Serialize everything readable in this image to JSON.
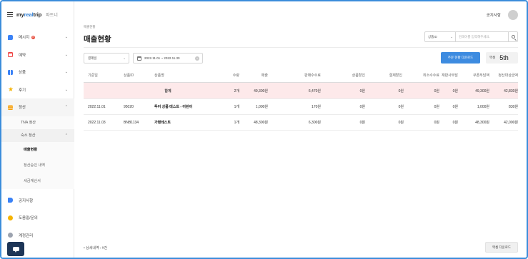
{
  "brand": {
    "logo_prefix": "my",
    "logo_accent": "real",
    "logo_suffix": "trip",
    "partner_label": "파트너"
  },
  "colors": {
    "accent": "#3d8be0",
    "total_row": "#fde9ea",
    "frame": "#3b8ddb",
    "sidebar_active": "#f5f5f5"
  },
  "sidebar": {
    "items": [
      {
        "label": "메시지",
        "icon": "message-icon",
        "icon_color": "#3b82f6",
        "badge": "N"
      },
      {
        "label": "예약",
        "icon": "calendar-icon",
        "icon_color": "#ef4444"
      },
      {
        "label": "상품",
        "icon": "grid-icon",
        "icon_color": "#3b82f6"
      },
      {
        "label": "후기",
        "icon": "star-icon",
        "icon_color": "#f5b301"
      },
      {
        "label": "정산",
        "icon": "settlement-icon",
        "icon_color": "#f59e0b"
      }
    ],
    "settlement_sub": [
      {
        "label": "TNA 정산"
      },
      {
        "label": "숙소 정산"
      }
    ],
    "lodging_sub": [
      {
        "label": "매출현황"
      },
      {
        "label": "정산승인 내역"
      },
      {
        "label": "세금계산서"
      }
    ],
    "bottom_items": [
      {
        "label": "공지사항",
        "icon": "megaphone-icon",
        "icon_color": "#3b82f6"
      },
      {
        "label": "도움말/문의",
        "icon": "help-icon",
        "icon_color": "#f5b301"
      },
      {
        "label": "계정관리",
        "icon": "gear-icon",
        "icon_color": "#9ca3af"
      }
    ]
  },
  "topbar": {
    "notice": "공지사항"
  },
  "page": {
    "breadcrumb": "매출현황",
    "title": "매출현황"
  },
  "search": {
    "select_value": "상품ID",
    "placeholder": "검색어를 입력해주세요."
  },
  "filters": {
    "period_value": "결제일",
    "date_range": "2022.11.01 ~ 2022.11.30"
  },
  "actions": {
    "download_label": "주문 현황 다운로드",
    "excel_small": "엑셀",
    "excel_big": "5th"
  },
  "table": {
    "headers": [
      "기준일",
      "상품ID",
      "상품명",
      "수량",
      "매출",
      "판매수수료",
      "상품할인",
      "결제할인",
      "취소수수료",
      "재판사부담",
      "쿠폰부담액",
      "정산대상금액"
    ],
    "total": {
      "label": "합계",
      "qty": "2개",
      "sales": "49,300원",
      "fee": "6,470원",
      "disc": "0원",
      "pay": "0원",
      "cancel": "0원",
      "burden": "0원",
      "coupon": "49,300원",
      "settle": "42,830원"
    },
    "rows": [
      {
        "date": "2022.11.01",
        "pid": "95020",
        "pname": "투어 상품 테스트 - 어린이",
        "qty": "1개",
        "sales": "1,000원",
        "fee": "170원",
        "disc": "0원",
        "pay": "0원",
        "cancel": "0원",
        "burden": "0원",
        "coupon": "1,000원",
        "settle": "830원"
      },
      {
        "date": "2022.11.03",
        "pid": "BNB1134",
        "pname": "가평테스트",
        "qty": "1개",
        "sales": "48,300원",
        "fee": "6,300원",
        "disc": "0원",
        "pay": "0원",
        "cancel": "0원",
        "burden": "0원",
        "coupon": "48,300원",
        "settle": "42,000원"
      }
    ]
  },
  "footer": {
    "note": "• 상세내역 : #건",
    "excel_download": "엑셀 다운로드"
  }
}
